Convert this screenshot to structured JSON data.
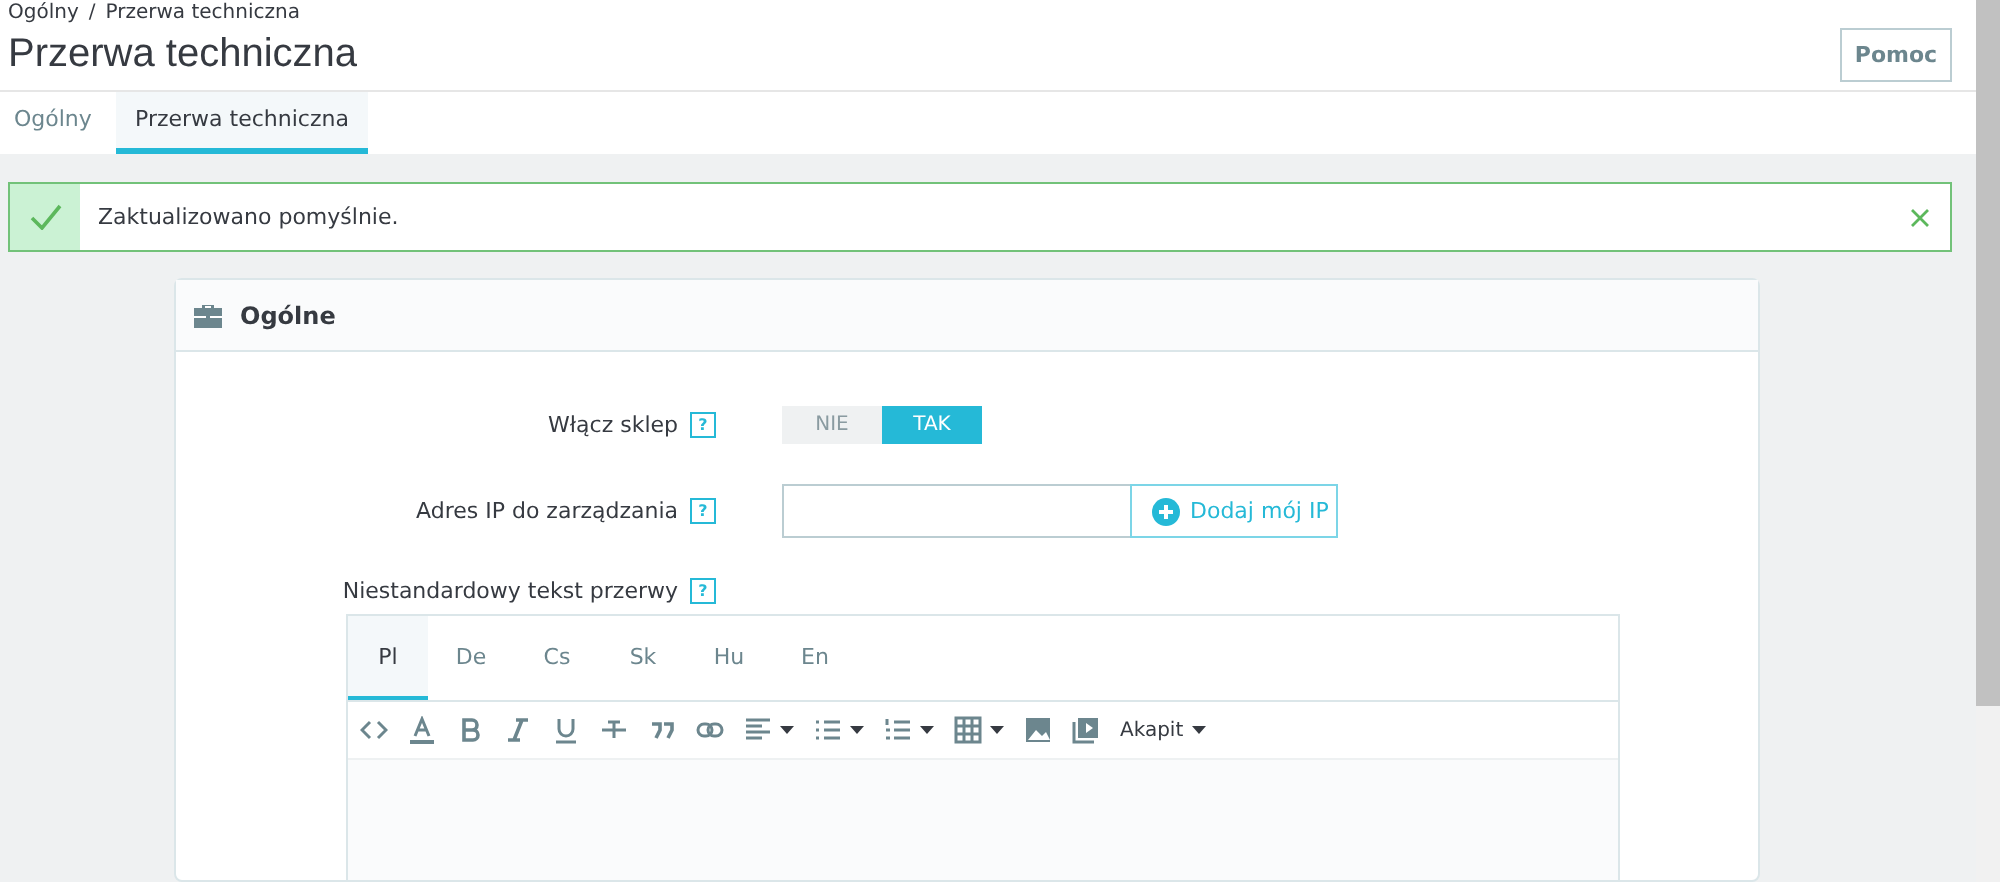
{
  "breadcrumb": [
    "Ogólny",
    "Przerwa techniczna"
  ],
  "breadcrumb_separator": "/",
  "page_title": "Przerwa techniczna",
  "help_button": "Pomoc",
  "tabs": [
    {
      "label": "Ogólny",
      "selected": false
    },
    {
      "label": "Przerwa techniczna",
      "selected": true
    }
  ],
  "alert": {
    "message": "Zaktualizowano pomyślnie."
  },
  "card": {
    "title": "Ogólne",
    "fields": [
      {
        "kind": "switch",
        "label": "Włącz sklep",
        "help": "?",
        "options": [
          {
            "label": "NIE",
            "selected": false
          },
          {
            "label": "TAK",
            "selected": true
          }
        ]
      },
      {
        "kind": "ip",
        "label": "Adres IP do zarządzania",
        "help": "?",
        "button": "Dodaj mój IP"
      },
      {
        "kind": "editor",
        "label": "Niestandardowy tekst przerwy",
        "help": "?"
      }
    ],
    "editor": {
      "languages": [
        {
          "label": "Pl",
          "selected": true
        },
        {
          "label": "De",
          "selected": false
        },
        {
          "label": "Cs",
          "selected": false
        },
        {
          "label": "Sk",
          "selected": false
        },
        {
          "label": "Hu",
          "selected": false
        },
        {
          "label": "En",
          "selected": false
        }
      ],
      "toolbar": [
        {
          "kind": "code",
          "dropdown": false
        },
        {
          "kind": "font-color",
          "dropdown": false
        },
        {
          "kind": "bold",
          "dropdown": false
        },
        {
          "kind": "italic",
          "dropdown": false
        },
        {
          "kind": "underline",
          "dropdown": false
        },
        {
          "kind": "strike",
          "dropdown": false
        },
        {
          "kind": "quote",
          "dropdown": false
        },
        {
          "kind": "link",
          "dropdown": false
        },
        {
          "kind": "align",
          "dropdown": true
        },
        {
          "kind": "bullet-list",
          "dropdown": true
        },
        {
          "kind": "numbered-list",
          "dropdown": true
        },
        {
          "kind": "table",
          "dropdown": true
        },
        {
          "kind": "image",
          "dropdown": false
        },
        {
          "kind": "media",
          "dropdown": false
        }
      ],
      "format": "Akapit"
    }
  }
}
